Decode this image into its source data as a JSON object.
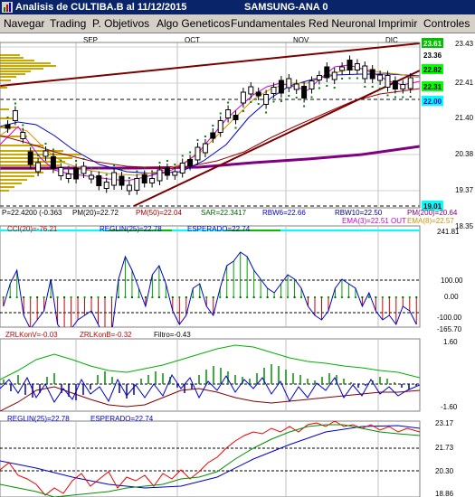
{
  "window": {
    "title": "Analisis de CULTIBA.B al 11/12/2015",
    "subtitle": "SAMSUNG-ANA 0"
  },
  "menu": [
    {
      "label": "Navegar"
    },
    {
      "label": "Trading"
    },
    {
      "label": "P. Objetivos"
    },
    {
      "label": "Algo Geneticos"
    },
    {
      "label": "Fundamentales"
    },
    {
      "label": "Red Neuronal"
    },
    {
      "label": "Imprimir"
    },
    {
      "label": "Controles"
    }
  ],
  "months": [
    "SEP",
    "OCT",
    "NOV",
    "DIC"
  ],
  "price_panel": {
    "right_axis": [
      "23.43",
      "22.41",
      "21.40",
      "20.38",
      "19.37",
      "18.35"
    ],
    "price_badges": [
      {
        "text": "23.61",
        "color": "#008000",
        "bg": "#00ff00"
      },
      {
        "text": "23.36",
        "color": "#000000",
        "bg": "#ffffff"
      },
      {
        "text": "22.82",
        "color": "#000000",
        "bg": "#00ff00"
      },
      {
        "text": "22.31",
        "color": "#000000",
        "bg": "#00ff00"
      },
      {
        "text": "22.00",
        "color": "#0000ff",
        "bg": "#00ffff"
      },
      {
        "text": "19.01",
        "color": "#000000",
        "bg": "#00ffff"
      }
    ],
    "info_row1": [
      {
        "text": "P=22.4200 (-0.363",
        "color": "#000000"
      },
      {
        "text": "PM(20)=22.72",
        "color": "#000000"
      },
      {
        "text": "PM(50)=22.04",
        "color": "#a00000"
      },
      {
        "text": "SAR=22.3417",
        "color": "#006000"
      },
      {
        "text": "RBW6=22.66",
        "color": "#0000cc"
      },
      {
        "text": "RBW10=22.50",
        "color": "#000080"
      },
      {
        "text": "PM(200)=20.64",
        "color": "#800080"
      }
    ],
    "info_row2": [
      {
        "text": "EMA(3)=22.51 OUT",
        "color": "#cc00cc"
      },
      {
        "text": "EMA(8)=22.57",
        "color": "#d09000"
      }
    ]
  },
  "cci_panel": {
    "labels": [
      {
        "text": "CCI(20)=-76.21",
        "color": "#cc0000"
      },
      {
        "text": "REGLIN(25)=22.78",
        "color": "#0000cc"
      },
      {
        "text": "ESPERADO=22.74",
        "color": "#0000cc"
      }
    ],
    "right_axis": [
      "241.81",
      "100.00",
      "0.00",
      "-100.00",
      "-165.70"
    ]
  },
  "zrl_panel": {
    "labels": [
      {
        "text": "ZRLKonV=-0.03",
        "color": "#cc0000"
      },
      {
        "text": "ZRLKonB=-0.32",
        "color": "#cc0000"
      },
      {
        "text": "Filtro=-0.43",
        "color": "#000000"
      }
    ],
    "right_axis": [
      "1.60",
      "-1.60"
    ]
  },
  "reg_panel": {
    "labels": [
      {
        "text": "REGLIN(25)=22.78",
        "color": "#0000cc"
      },
      {
        "text": "ESPERADO=22.74",
        "color": "#0000cc"
      }
    ],
    "right_axis": [
      "23.17",
      "21.73",
      "20.30",
      "18.86"
    ]
  }
}
